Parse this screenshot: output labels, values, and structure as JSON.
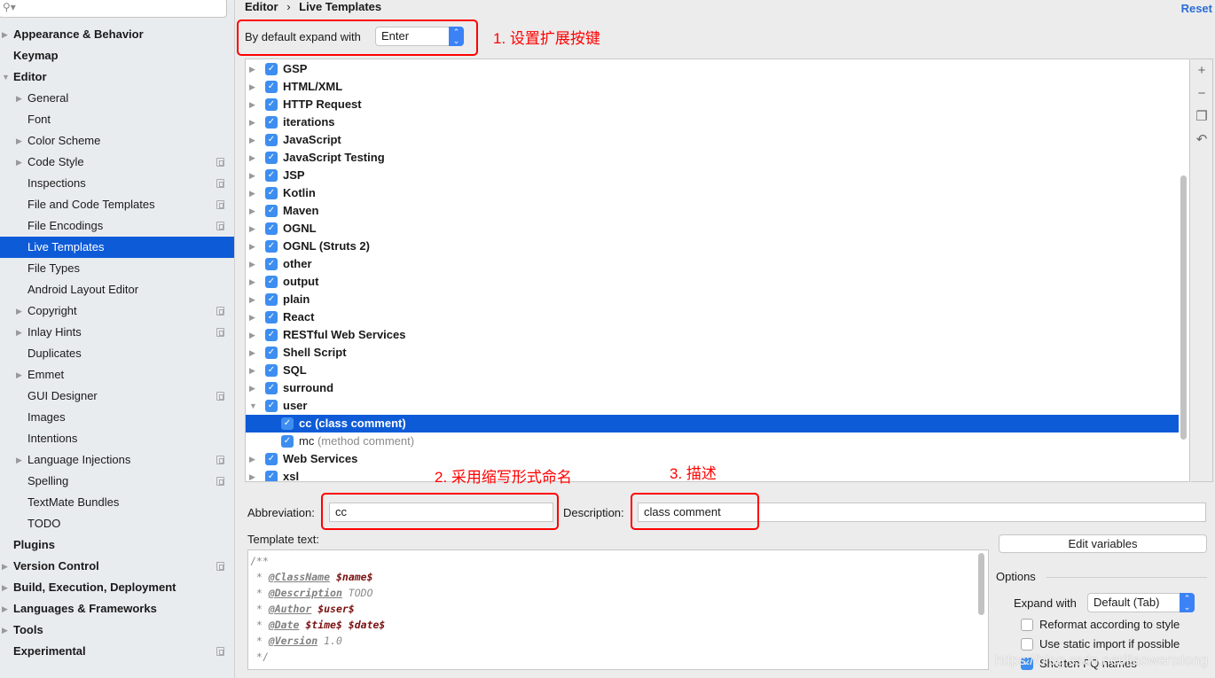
{
  "sidebar": {
    "search_placeholder": "",
    "items": [
      {
        "label": "Appearance & Behavior",
        "bold": true,
        "level": 0,
        "arrow": "right",
        "copy": false
      },
      {
        "label": "Keymap",
        "bold": true,
        "level": 0,
        "arrow": "",
        "copy": false
      },
      {
        "label": "Editor",
        "bold": true,
        "level": 0,
        "arrow": "down",
        "copy": false
      },
      {
        "label": "General",
        "level": 1,
        "arrow": "right",
        "copy": false
      },
      {
        "label": "Font",
        "level": 1,
        "arrow": "",
        "copy": false
      },
      {
        "label": "Color Scheme",
        "level": 1,
        "arrow": "right",
        "copy": false
      },
      {
        "label": "Code Style",
        "level": 1,
        "arrow": "right",
        "copy": true
      },
      {
        "label": "Inspections",
        "level": 1,
        "arrow": "",
        "copy": true
      },
      {
        "label": "File and Code Templates",
        "level": 1,
        "arrow": "",
        "copy": true
      },
      {
        "label": "File Encodings",
        "level": 1,
        "arrow": "",
        "copy": true
      },
      {
        "label": "Live Templates",
        "level": 1,
        "arrow": "",
        "copy": false,
        "selected": true
      },
      {
        "label": "File Types",
        "level": 1,
        "arrow": "",
        "copy": false
      },
      {
        "label": "Android Layout Editor",
        "level": 1,
        "arrow": "",
        "copy": false
      },
      {
        "label": "Copyright",
        "level": 1,
        "arrow": "right",
        "copy": true
      },
      {
        "label": "Inlay Hints",
        "level": 1,
        "arrow": "right",
        "copy": true
      },
      {
        "label": "Duplicates",
        "level": 1,
        "arrow": "",
        "copy": false
      },
      {
        "label": "Emmet",
        "level": 1,
        "arrow": "right",
        "copy": false
      },
      {
        "label": "GUI Designer",
        "level": 1,
        "arrow": "",
        "copy": true
      },
      {
        "label": "Images",
        "level": 1,
        "arrow": "",
        "copy": false
      },
      {
        "label": "Intentions",
        "level": 1,
        "arrow": "",
        "copy": false
      },
      {
        "label": "Language Injections",
        "level": 1,
        "arrow": "right",
        "copy": true
      },
      {
        "label": "Spelling",
        "level": 1,
        "arrow": "",
        "copy": true
      },
      {
        "label": "TextMate Bundles",
        "level": 1,
        "arrow": "",
        "copy": false
      },
      {
        "label": "TODO",
        "level": 1,
        "arrow": "",
        "copy": false
      },
      {
        "label": "Plugins",
        "bold": true,
        "level": 0,
        "arrow": "",
        "copy": false
      },
      {
        "label": "Version Control",
        "bold": true,
        "level": 0,
        "arrow": "right",
        "copy": true
      },
      {
        "label": "Build, Execution, Deployment",
        "bold": true,
        "level": 0,
        "arrow": "right",
        "copy": false
      },
      {
        "label": "Languages & Frameworks",
        "bold": true,
        "level": 0,
        "arrow": "right",
        "copy": false
      },
      {
        "label": "Tools",
        "bold": true,
        "level": 0,
        "arrow": "right",
        "copy": false
      },
      {
        "label": "Experimental",
        "bold": true,
        "level": 0,
        "arrow": "",
        "copy": true
      }
    ]
  },
  "breadcrumb": {
    "parent": "Editor",
    "separator": "›",
    "current": "Live Templates"
  },
  "reset_label": "Reset",
  "expand_default": {
    "label": "By default expand with",
    "value": "Enter"
  },
  "annotations": [
    "1. 设置扩展按键",
    "2. 采用缩写形式命名",
    "3. 描述"
  ],
  "tree": [
    {
      "label": "GSP",
      "arrow": "right"
    },
    {
      "label": "HTML/XML",
      "arrow": "right"
    },
    {
      "label": "HTTP Request",
      "arrow": "right"
    },
    {
      "label": "iterations",
      "arrow": "right"
    },
    {
      "label": "JavaScript",
      "arrow": "right"
    },
    {
      "label": "JavaScript Testing",
      "arrow": "right"
    },
    {
      "label": "JSP",
      "arrow": "right"
    },
    {
      "label": "Kotlin",
      "arrow": "right"
    },
    {
      "label": "Maven",
      "arrow": "right"
    },
    {
      "label": "OGNL",
      "arrow": "right"
    },
    {
      "label": "OGNL (Struts 2)",
      "arrow": "right"
    },
    {
      "label": "other",
      "arrow": "right"
    },
    {
      "label": "output",
      "arrow": "right"
    },
    {
      "label": "plain",
      "arrow": "right"
    },
    {
      "label": "React",
      "arrow": "right"
    },
    {
      "label": "RESTful Web Services",
      "arrow": "right"
    },
    {
      "label": "Shell Script",
      "arrow": "right"
    },
    {
      "label": "SQL",
      "arrow": "right"
    },
    {
      "label": "surround",
      "arrow": "right"
    },
    {
      "label": "user",
      "arrow": "down"
    },
    {
      "label": "cc",
      "desc": "(class comment)",
      "child": true,
      "selected": true
    },
    {
      "label": "mc",
      "desc": "(method comment)",
      "child": true
    },
    {
      "label": "Web Services",
      "arrow": "right"
    },
    {
      "label": "xsl",
      "arrow": "right"
    }
  ],
  "toolbar": {
    "icons": [
      "plus-icon",
      "minus-icon",
      "copy-icon",
      "revert-icon"
    ],
    "glyphs": [
      "+",
      "−",
      "❐",
      "↶"
    ]
  },
  "abbreviation": {
    "label": "Abbreviation:",
    "value": "cc"
  },
  "description": {
    "label": "Description:",
    "value": "class comment"
  },
  "template": {
    "label": "Template text:",
    "lines": [
      [
        {
          "t": "/**",
          "c": ""
        }
      ],
      [
        {
          "t": " * ",
          "c": ""
        },
        {
          "t": "@ClassName",
          "c": "tag"
        },
        {
          "t": " ",
          "c": ""
        },
        {
          "t": "$name$",
          "c": "var"
        }
      ],
      [
        {
          "t": " * ",
          "c": ""
        },
        {
          "t": "@Description",
          "c": "tag"
        },
        {
          "t": " TODO",
          "c": "it"
        }
      ],
      [
        {
          "t": " * ",
          "c": ""
        },
        {
          "t": "@Author",
          "c": "tag"
        },
        {
          "t": " ",
          "c": ""
        },
        {
          "t": "$user$",
          "c": "var"
        }
      ],
      [
        {
          "t": " * ",
          "c": ""
        },
        {
          "t": "@Date",
          "c": "tag"
        },
        {
          "t": " ",
          "c": ""
        },
        {
          "t": "$time$ $date$",
          "c": "var"
        }
      ],
      [
        {
          "t": " * ",
          "c": ""
        },
        {
          "t": "@Version",
          "c": "tag"
        },
        {
          "t": " 1.0",
          "c": "it"
        }
      ],
      [
        {
          "t": " */",
          "c": ""
        }
      ]
    ]
  },
  "edit_variables_label": "Edit variables",
  "options": {
    "title": "Options",
    "expand_label": "Expand with",
    "expand_value": "Default (Tab)",
    "checks": [
      {
        "label": "Reformat according to style",
        "checked": false
      },
      {
        "label": "Use static import if possible",
        "checked": false
      },
      {
        "label": "Shorten FQ names",
        "checked": true
      }
    ]
  },
  "watermark": "https://blog.csdn.net/liaowenxiong",
  "colors": {
    "selection": "#0e5bd8",
    "checkbox": "#3d8ef0",
    "annotation": "#ff0000",
    "link": "#2c6cd6"
  }
}
